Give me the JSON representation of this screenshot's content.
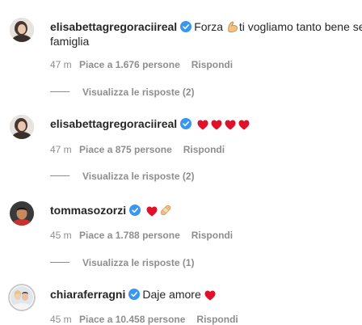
{
  "comments": [
    {
      "username": "elisabettagregoraciireal",
      "text_before_emoji": "Forza ",
      "text_after_emoji": "ti vogliamo tanto bene sei",
      "text_line2": "famiglia",
      "time": "47 m",
      "likes": "Piace a 1.676 persone",
      "reply": "Rispondi",
      "view_replies": "Visualizza le risposte (2)"
    },
    {
      "username": "elisabettagregoraciireal",
      "time": "47 m",
      "likes": "Piace a 875 persone",
      "reply": "Rispondi",
      "view_replies": "Visualizza le risposte (2)"
    },
    {
      "username": "tommasozorzi",
      "time": "45 m",
      "likes": "Piace a 1.788 persone",
      "reply": "Rispondi",
      "view_replies": "Visualizza le risposte (1)"
    },
    {
      "username": "chiaraferragni",
      "text": "Daje amore",
      "time": "45 m",
      "likes": "Piace a 10.458 persone",
      "reply": "Rispondi"
    }
  ],
  "colors": {
    "verified": "#3897f0",
    "heart": "#e0112b",
    "meta": "#8e8e8e",
    "text": "#262626"
  },
  "icons": {
    "verified": "verified-badge-icon",
    "heart": "red-heart-emoji",
    "biceps": "flexed-biceps-emoji",
    "bandage": "adhesive-bandage-emoji"
  }
}
